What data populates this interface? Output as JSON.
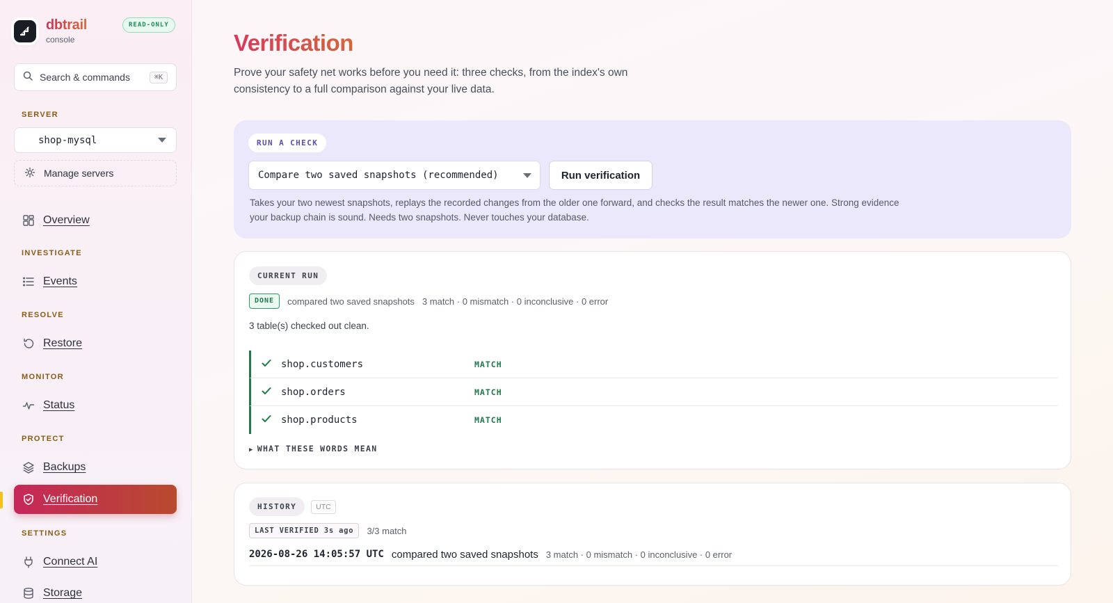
{
  "app": {
    "name": "dbtrail",
    "subtitle": "console",
    "mode_badge": "READ-ONLY"
  },
  "search": {
    "placeholder": "Search & commands",
    "shortcut": "⌘K"
  },
  "server": {
    "section_label": "SERVER",
    "selected": "shop-mysql",
    "manage_label": "Manage servers"
  },
  "nav": {
    "overview": "Overview",
    "investigate_label": "INVESTIGATE",
    "events": "Events",
    "resolve_label": "RESOLVE",
    "restore": "Restore",
    "monitor_label": "MONITOR",
    "status": "Status",
    "protect_label": "PROTECT",
    "backups": "Backups",
    "verification": "Verification",
    "settings_label": "SETTINGS",
    "connect_ai": "Connect AI",
    "storage": "Storage"
  },
  "page": {
    "title": "Verification",
    "description": "Prove your safety net works before you need it: three checks, from the index's own consistency to a full comparison against your live data."
  },
  "run_check": {
    "label": "RUN A CHECK",
    "selected_check": "Compare two saved snapshots (recommended)",
    "run_button": "Run verification",
    "help": "Takes your two newest snapshots, replays the recorded changes from the older one forward, and checks the result matches the newer one. Strong evidence your backup chain is sound. Needs two snapshots. Never touches your database."
  },
  "current_run": {
    "label": "CURRENT RUN",
    "state": "DONE",
    "kind": "compared two saved snapshots",
    "summary": "3 match · 0 mismatch · 0 inconclusive · 0 error",
    "result_text": "3 table(s) checked out clean.",
    "tables": [
      {
        "name": "shop.customers",
        "result": "MATCH"
      },
      {
        "name": "shop.orders",
        "result": "MATCH"
      },
      {
        "name": "shop.products",
        "result": "MATCH"
      }
    ],
    "disclosure": "WHAT THESE WORDS MEAN"
  },
  "history": {
    "label": "HISTORY",
    "tz": "UTC",
    "last_verified": "LAST VERIFIED 3s ago",
    "last_verified_summary": "3/3 match",
    "entries": [
      {
        "timestamp": "2026-08-26 14:05:57 UTC",
        "kind": "compared two saved snapshots",
        "summary": "3 match · 0 mismatch · 0 inconclusive · 0 error"
      }
    ]
  },
  "colors": {
    "accent_start": "#c6275b",
    "accent_end": "#b84a2e",
    "success": "#1e7a4a",
    "run_card_bg": "#ece8fb"
  }
}
